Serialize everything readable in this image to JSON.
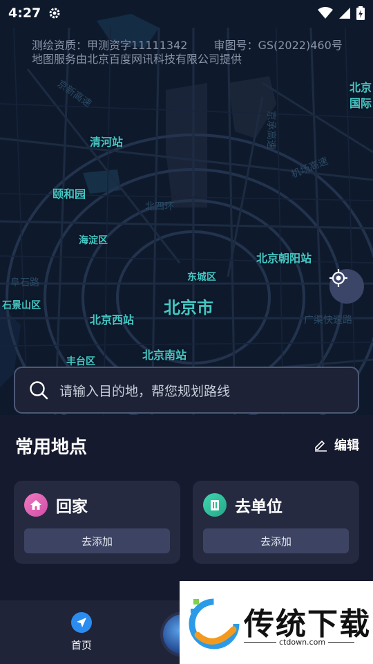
{
  "status_bar": {
    "time": "4:27"
  },
  "map": {
    "copyright_line1_a": "测绘资质：甲测资字11111342",
    "copyright_line1_b": "审图号：GS(2022)460号",
    "copyright_line2": "地图服务由北京百度网讯科技有限公司提供",
    "labels": {
      "qinghe": "清河站",
      "yiheyuan": "颐和园",
      "haidian": "海淀区",
      "shijingshan": "石景山区",
      "dongcheng": "东城区",
      "beijing_city": "北京市",
      "beijing_west": "北京西站",
      "chaoyang_station": "北京朝阳站",
      "fengtai": "丰台区",
      "beijing_south": "北京南站",
      "intl_a": "北京",
      "intl_b": "国际"
    },
    "road_labels": {
      "r1": "京新高速",
      "r2": "京承高速",
      "r3": "机场高速",
      "r4": "北四环",
      "r5": "阜石路",
      "r6": "广渠快速路",
      "r7": "北五环"
    }
  },
  "search": {
    "placeholder": "请输入目的地，帮您规划路线"
  },
  "favorites": {
    "title": "常用地点",
    "edit_label": "编辑",
    "home": {
      "name": "回家",
      "add_label": "去添加",
      "color": "#e05aa8"
    },
    "work": {
      "name": "去单位",
      "add_label": "去添加",
      "color": "#2fbf9a"
    }
  },
  "bottom_nav": {
    "home_label": "首页"
  },
  "watermark": {
    "title": "传统下载",
    "url": "ctdown.com"
  },
  "colors": {
    "map_label": "#45c7c3",
    "background": "#161a2e"
  }
}
